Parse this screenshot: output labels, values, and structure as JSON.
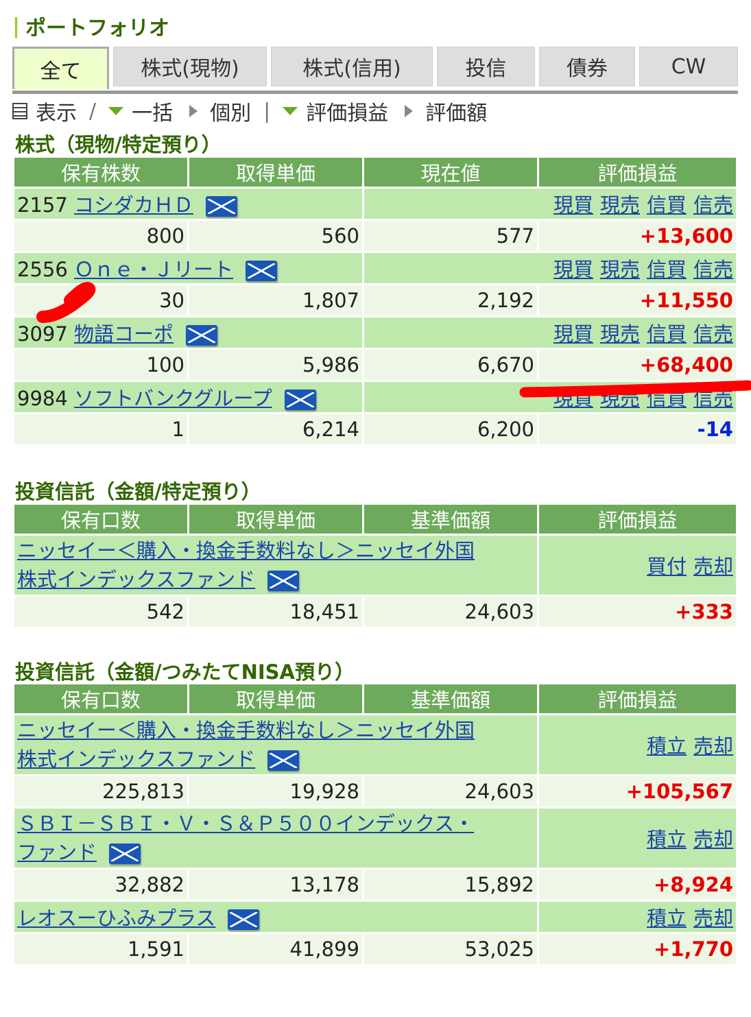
{
  "page_title": "ポートフォリオ",
  "tabs": [
    "全て",
    "株式(現物)",
    "株式(信用)",
    "投信",
    "債券",
    "CW"
  ],
  "toolbar": {
    "view": "表示",
    "slash": "/",
    "bulk": "一括",
    "individual": "個別",
    "sep": "|",
    "gain": "評価損益",
    "value": "評価額"
  },
  "sections": {
    "stocks": {
      "title": "株式（現物/特定預り）",
      "headers": [
        "保有株数",
        "取得単価",
        "現在値",
        "評価損益"
      ],
      "actions": [
        "現買",
        "現売",
        "信買",
        "信売"
      ],
      "rows": [
        {
          "code": "2157",
          "name": "コシダカＨＤ",
          "qty": "800",
          "cost": "560",
          "price": "577",
          "gain": "+13,600"
        },
        {
          "code": "2556",
          "name": "Ｏｎｅ・Ｊリート",
          "qty": "30",
          "cost": "1,807",
          "price": "2,192",
          "gain": "+11,550"
        },
        {
          "code": "3097",
          "name": "物語コーポ",
          "qty": "100",
          "cost": "5,986",
          "price": "6,670",
          "gain": "+68,400"
        },
        {
          "code": "9984",
          "name": "ソフトバンクグループ",
          "qty": "1",
          "cost": "6,214",
          "price": "6,200",
          "gain": "-14"
        }
      ]
    },
    "funds_specific": {
      "title": "投資信託（金額/特定預り）",
      "headers": [
        "保有口数",
        "取得単価",
        "基準価額",
        "評価損益"
      ],
      "actions": [
        "買付",
        "売却"
      ],
      "rows": [
        {
          "name_line1": "ニッセイー＜購入・換金手数料なし＞ニッセイ外国",
          "name_line2": "株式インデックスファンド",
          "qty": "542",
          "cost": "18,451",
          "price": "24,603",
          "gain": "+333"
        }
      ]
    },
    "funds_nisa": {
      "title": "投資信託（金額/つみたてNISA預り）",
      "headers": [
        "保有口数",
        "取得単価",
        "基準価額",
        "評価損益"
      ],
      "actions": [
        "積立",
        "売却"
      ],
      "rows": [
        {
          "name_line1": "ニッセイー＜購入・換金手数料なし＞ニッセイ外国",
          "name_line2": "株式インデックスファンド",
          "qty": "225,813",
          "cost": "19,928",
          "price": "24,603",
          "gain": "+105,567"
        },
        {
          "name_line1": "ＳＢＩ－ＳＢＩ・Ｖ・Ｓ＆Ｐ５００インデックス・",
          "name_line2": "ファンド",
          "qty": "32,882",
          "cost": "13,178",
          "price": "15,892",
          "gain": "+8,924"
        },
        {
          "name_line1": "レオスーひふみプラス",
          "name_line2": "",
          "qty": "1,591",
          "cost": "41,899",
          "price": "53,025",
          "gain": "+1,770"
        }
      ]
    }
  },
  "colors": {
    "accent": "#336600",
    "header_bg": "#6daa5c",
    "name_row_bg": "#bfe8ad",
    "value_row_bg": "#eef7e6",
    "positive": "#e60000",
    "negative": "#0022dd",
    "link": "#1a44a6",
    "annotation": "#ff0000"
  }
}
